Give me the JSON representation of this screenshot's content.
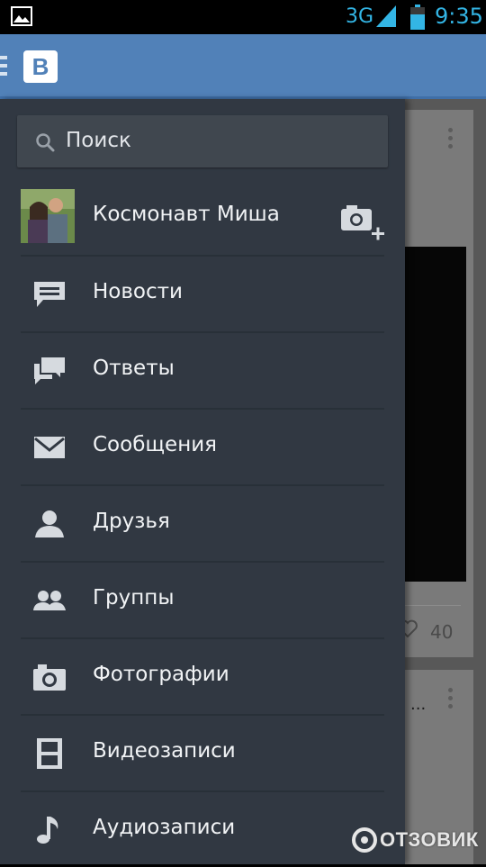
{
  "status_bar": {
    "network": "3G",
    "time": "9:35",
    "icons": [
      "gallery-icon",
      "signal-icon",
      "battery-icon"
    ]
  },
  "app_bar": {
    "logo_text": "В",
    "icons": [
      "menu-icon"
    ],
    "color": "#5181b8"
  },
  "drawer": {
    "search": {
      "placeholder": "Поиск"
    },
    "profile": {
      "name": "Космонавт Миша",
      "icons": [
        "avatar",
        "add-photo-icon"
      ]
    },
    "items": [
      {
        "label": "Новости",
        "icon": "news-icon"
      },
      {
        "label": "Ответы",
        "icon": "replies-icon"
      },
      {
        "label": "Сообщения",
        "icon": "messages-icon"
      },
      {
        "label": "Друзья",
        "icon": "friends-icon"
      },
      {
        "label": "Группы",
        "icon": "groups-icon"
      },
      {
        "label": "Фотографии",
        "icon": "photos-icon"
      },
      {
        "label": "Видеозаписи",
        "icon": "videos-icon"
      },
      {
        "label": "Аудиозаписи",
        "icon": "audio-icon"
      }
    ],
    "background": "#313842"
  },
  "feed": {
    "likes_count": "40",
    "truncated_text": "..."
  },
  "watermark": {
    "text": "ОТЗОВИК"
  }
}
